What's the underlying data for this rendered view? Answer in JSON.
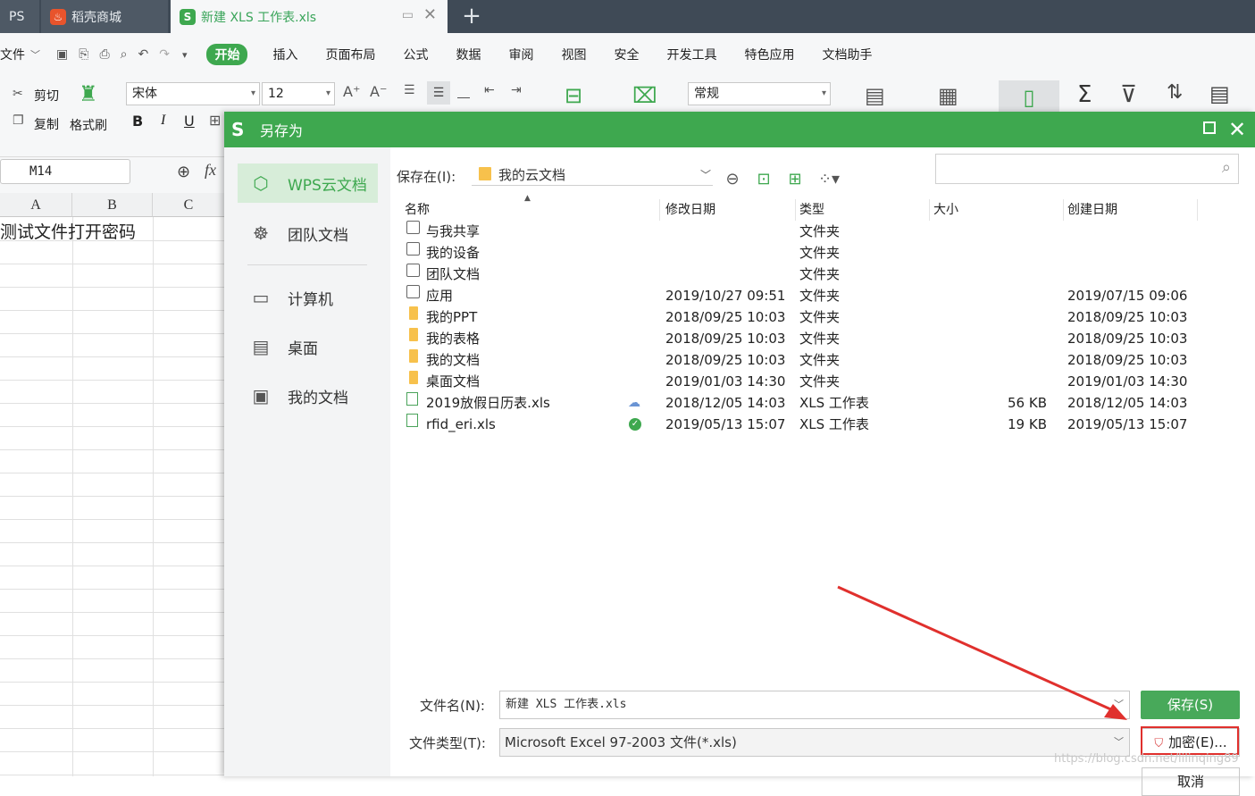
{
  "tabs": {
    "wps": "PS",
    "shop": "稻壳商城",
    "doc": "新建 XLS 工作表.xls",
    "plus": "+"
  },
  "menubar": {
    "file": "文件",
    "start": "开始",
    "items": [
      "插入",
      "页面布局",
      "公式",
      "数据",
      "审阅",
      "视图",
      "安全",
      "开发工具",
      "特色应用",
      "文档助手"
    ]
  },
  "ribbon": {
    "cut": "剪切",
    "copy": "复制",
    "format_painter": "格式刷",
    "font": "宋体",
    "font_size": "12",
    "number_format": "常规"
  },
  "sheet": {
    "name_box": "M14",
    "fx": "fx",
    "columns": [
      "A",
      "B",
      "C"
    ],
    "a1": "测试文件打开密码"
  },
  "dialog": {
    "title": "另存为",
    "sidebar": [
      "WPS云文档",
      "团队文档",
      "计算机",
      "桌面",
      "我的文档"
    ],
    "lookin_label": "保存在(I):",
    "lookin_value": "我的云文档",
    "columns": {
      "name": "名称",
      "modified": "修改日期",
      "type": "类型",
      "size": "大小",
      "created": "创建日期"
    },
    "files": [
      {
        "name": "与我共享",
        "modified": "",
        "type": "文件夹",
        "size": "",
        "created": "",
        "icon": "sys",
        "status": ""
      },
      {
        "name": "我的设备",
        "modified": "",
        "type": "文件夹",
        "size": "",
        "created": "",
        "icon": "sys",
        "status": ""
      },
      {
        "name": "团队文档",
        "modified": "",
        "type": "文件夹",
        "size": "",
        "created": "",
        "icon": "sys",
        "status": ""
      },
      {
        "name": "应用",
        "modified": "2019/10/27 09:51",
        "type": "文件夹",
        "size": "",
        "created": "2019/07/15 09:06",
        "icon": "sys",
        "status": ""
      },
      {
        "name": "我的PPT",
        "modified": "2018/09/25 10:03",
        "type": "文件夹",
        "size": "",
        "created": "2018/09/25 10:03",
        "icon": "folder",
        "status": ""
      },
      {
        "name": "我的表格",
        "modified": "2018/09/25 10:03",
        "type": "文件夹",
        "size": "",
        "created": "2018/09/25 10:03",
        "icon": "folder",
        "status": ""
      },
      {
        "name": "我的文档",
        "modified": "2018/09/25 10:03",
        "type": "文件夹",
        "size": "",
        "created": "2018/09/25 10:03",
        "icon": "folder",
        "status": ""
      },
      {
        "name": "桌面文档",
        "modified": "2019/01/03 14:30",
        "type": "文件夹",
        "size": "",
        "created": "2019/01/03 14:30",
        "icon": "folder",
        "status": ""
      },
      {
        "name": "2019放假日历表.xls",
        "modified": "2018/12/05 14:03",
        "type": "XLS 工作表",
        "size": "56 KB",
        "created": "2018/12/05 14:03",
        "icon": "xls",
        "status": "cloud"
      },
      {
        "name": "rfid_eri.xls",
        "modified": "2019/05/13 15:07",
        "type": "XLS 工作表",
        "size": "19 KB",
        "created": "2019/05/13 15:07",
        "icon": "xls",
        "status": "ok"
      }
    ],
    "filename_label": "文件名(N):",
    "filename_value": "新建 XLS 工作表.xls",
    "filetype_label": "文件类型(T):",
    "filetype_value": "Microsoft Excel 97-2003 文件(*.xls)",
    "save": "保存(S)",
    "encrypt": "加密(E)...",
    "cancel": "取消"
  },
  "watermark": "https://blog.csdn.net/lilinqing89",
  "colors": {
    "accent": "#3ea84f",
    "highlight": "#e0302d",
    "tabbar": "#3f4a56"
  }
}
